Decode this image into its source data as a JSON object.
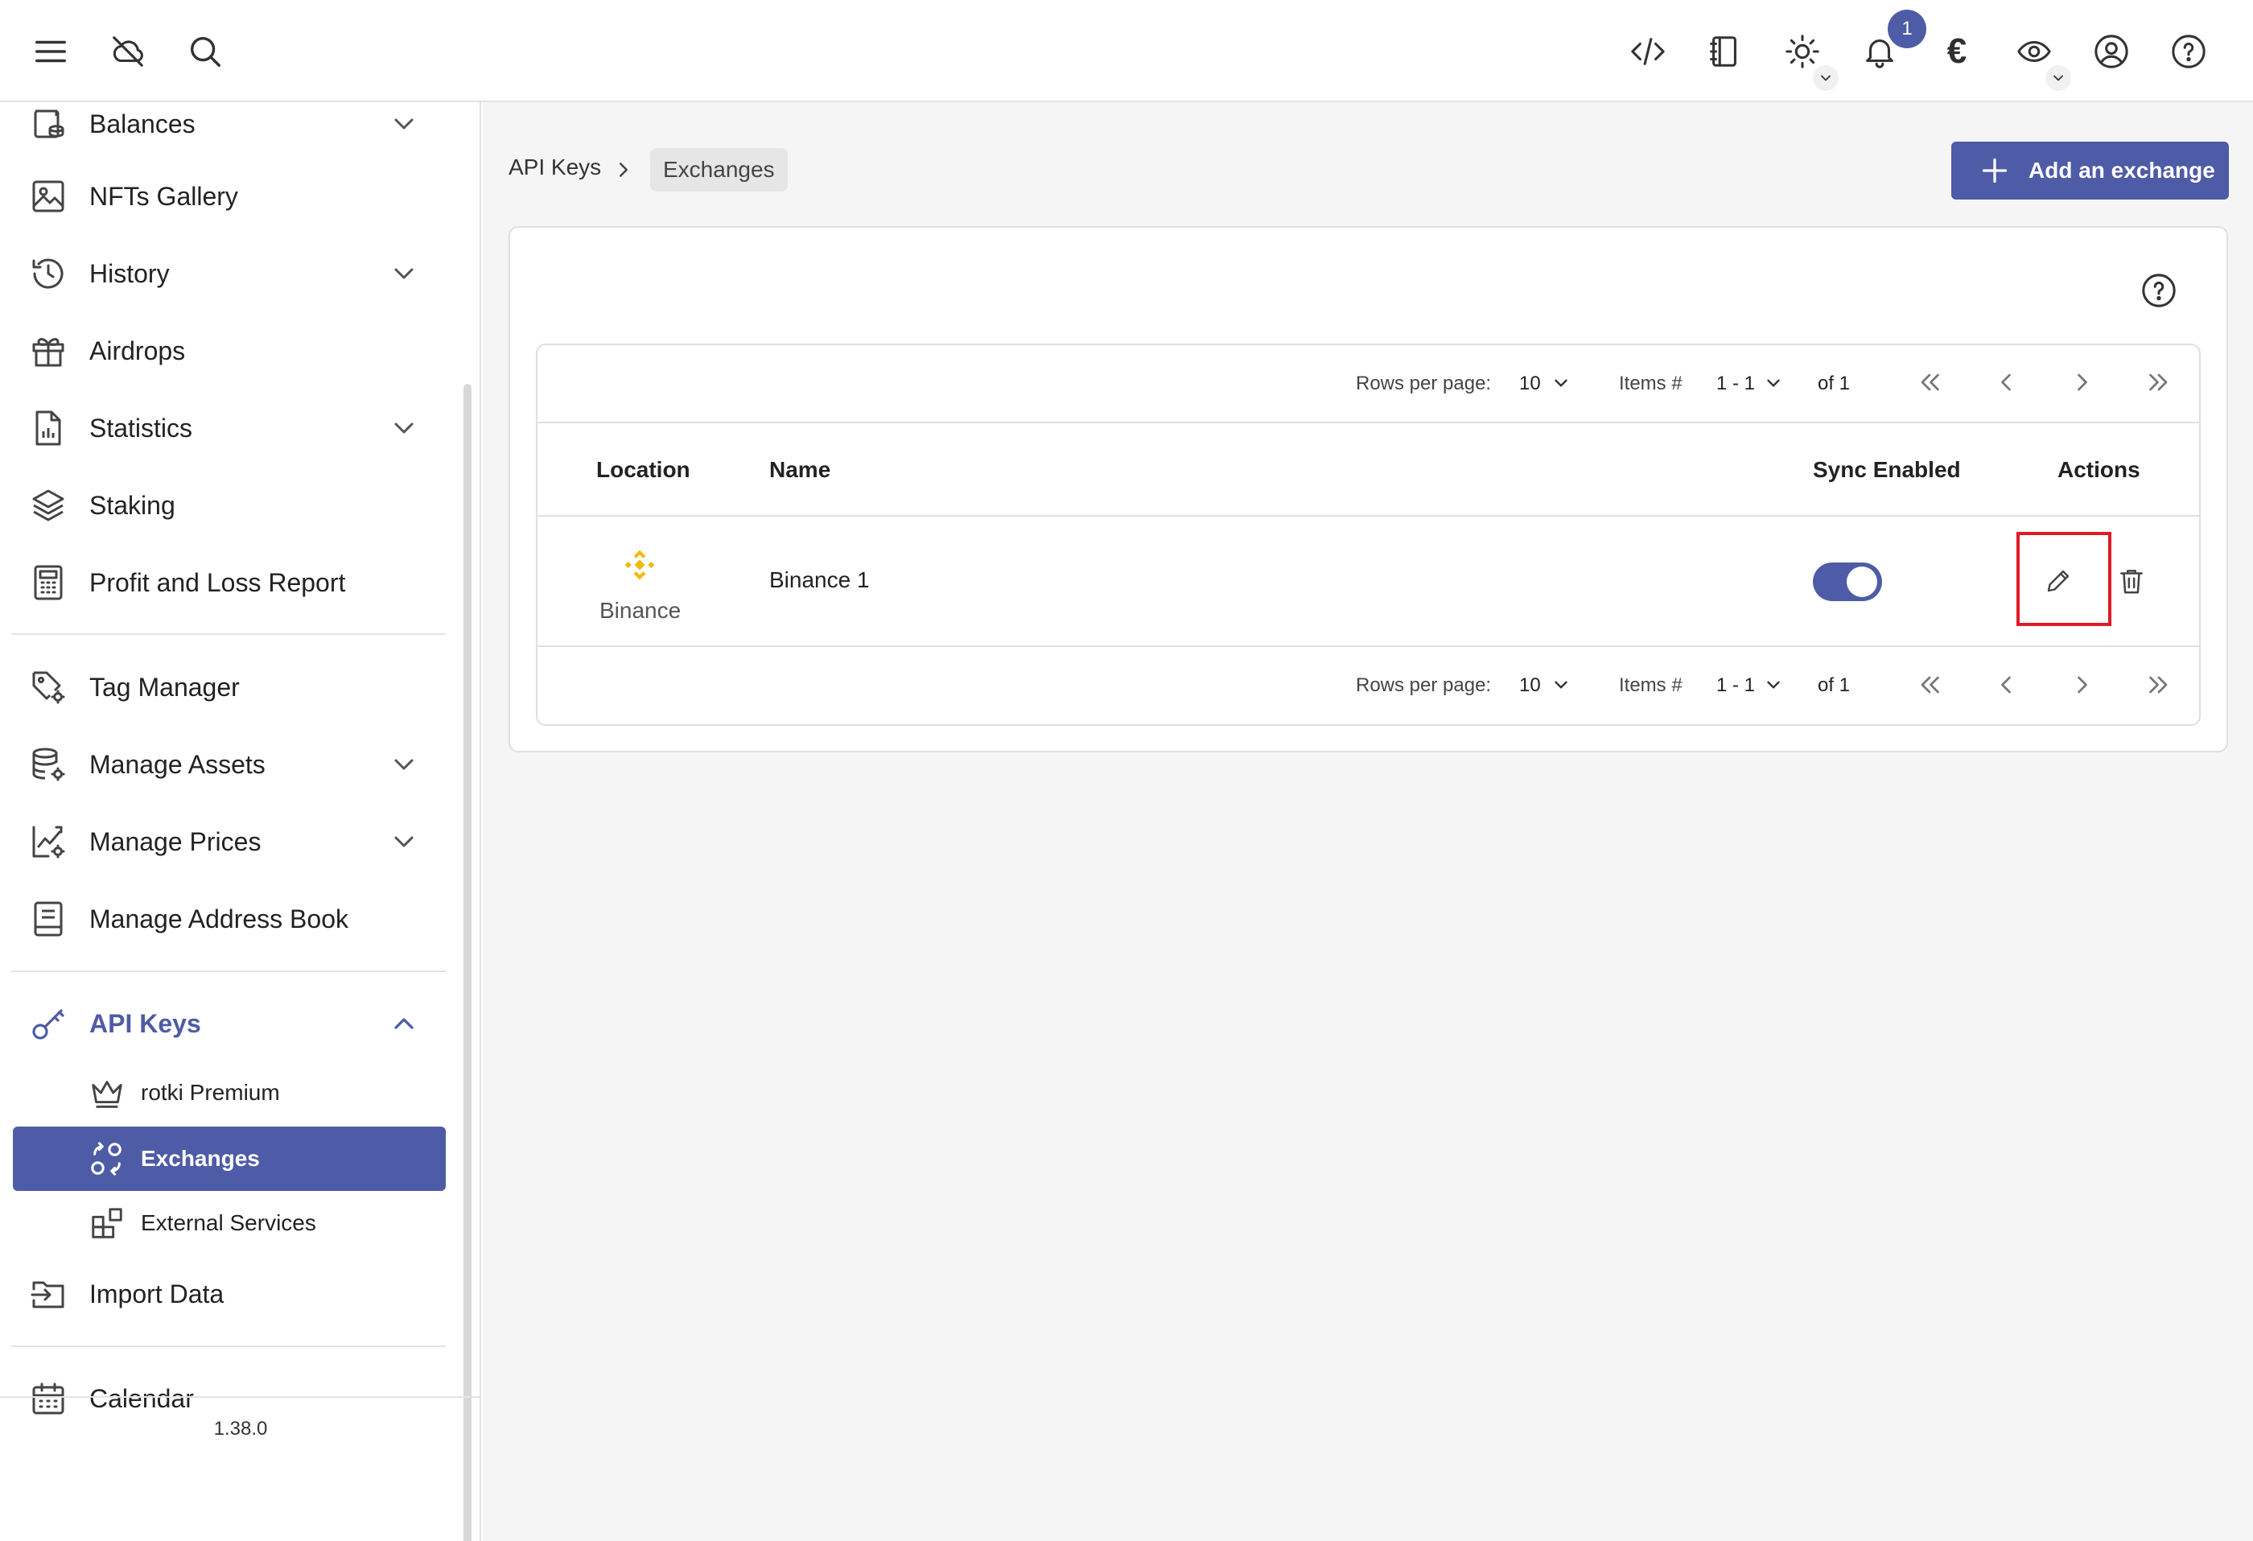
{
  "topbar": {
    "left_icons": [
      "menu-icon",
      "cloud-off-icon",
      "search-icon"
    ],
    "right_icons": [
      "code-icon",
      "notebook-icon",
      "sun-icon",
      "bell-icon",
      "euro-icon",
      "eye-icon",
      "account-icon",
      "help-icon"
    ],
    "notification_count": "1",
    "currency_symbol": "€"
  },
  "sidebar": {
    "items": [
      {
        "label": "Balances",
        "icon": "wallet-icon",
        "expandable": true
      },
      {
        "label": "NFTs Gallery",
        "icon": "image-icon",
        "expandable": false
      },
      {
        "label": "History",
        "icon": "history-icon",
        "expandable": true
      },
      {
        "label": "Airdrops",
        "icon": "gift-icon",
        "expandable": false
      },
      {
        "label": "Statistics",
        "icon": "file-chart-icon",
        "expandable": true
      },
      {
        "label": "Staking",
        "icon": "layers-icon",
        "expandable": false
      },
      {
        "label": "Profit and Loss Report",
        "icon": "calculator-icon",
        "expandable": false
      },
      {
        "label": "Tag Manager",
        "icon": "tag-gear-icon",
        "expandable": false
      },
      {
        "label": "Manage Assets",
        "icon": "database-gear-icon",
        "expandable": true
      },
      {
        "label": "Manage Prices",
        "icon": "chart-gear-icon",
        "expandable": true
      },
      {
        "label": "Manage Address Book",
        "icon": "book-icon",
        "expandable": false
      },
      {
        "label": "API Keys",
        "icon": "key-icon",
        "expandable": true,
        "expanded": true
      },
      {
        "label": "Import Data",
        "icon": "folder-import-icon",
        "expandable": false
      },
      {
        "label": "Calendar",
        "icon": "calendar-icon",
        "expandable": false
      }
    ],
    "api_keys_children": [
      {
        "label": "rotki Premium",
        "icon": "crown-icon"
      },
      {
        "label": "Exchanges",
        "icon": "exchange-icon",
        "selected": true
      },
      {
        "label": "External Services",
        "icon": "apps-add-icon"
      }
    ],
    "version": "1.38.0"
  },
  "breadcrumb": {
    "parent": "API Keys",
    "current": "Exchanges"
  },
  "actions": {
    "add_exchange": "Add an exchange"
  },
  "pagination": {
    "rows_per_page_label": "Rows per page:",
    "rows_per_page_value": "10",
    "items_label": "Items #",
    "items_range": "1 - 1",
    "of_label": "of 1"
  },
  "table": {
    "columns": [
      "Location",
      "Name",
      "Sync Enabled",
      "Actions"
    ],
    "rows": [
      {
        "location": "Binance",
        "name": "Binance 1",
        "sync_enabled": true
      }
    ]
  },
  "colors": {
    "accent": "#4e5ba6",
    "binance": "#f0b90b",
    "highlight": "#e01b24"
  }
}
